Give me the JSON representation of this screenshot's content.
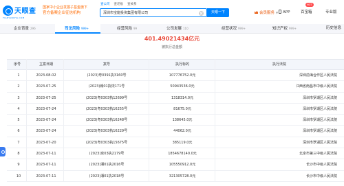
{
  "brand": {
    "name": "天眼查",
    "tagline": "TIANYANCHA.COM",
    "cert_line1": "国家中小企业发展子基金旗下",
    "cert_line2": "官方备案企业征信机构"
  },
  "search": {
    "tabs": [
      "查公司",
      "查老板",
      "查关系"
    ],
    "active_tab": 0,
    "value": "深圳市宝能投资集团有限公司",
    "button_label": "天眼一下"
  },
  "nav": {
    "member_label": "会员服务",
    "app_label": "APP",
    "home_label": "百宝箱",
    "home_badge": "HOT",
    "pro_label": "专业版"
  },
  "tabs": [
    {
      "label": "企业背景",
      "count": "296"
    },
    {
      "label": "司法风险",
      "count": "999+"
    },
    {
      "label": "经营风险",
      "count": "99"
    },
    {
      "label": "公司发展",
      "count": "110"
    },
    {
      "label": "经营状况",
      "count": "999+"
    },
    {
      "label": "知识产权",
      "count": "999+"
    },
    {
      "label": "历史信息",
      "count": ""
    }
  ],
  "active_tab_index": 1,
  "summary": {
    "amount": "401.49021434亿元",
    "label": "被执行总金额"
  },
  "table": {
    "headers": {
      "index": "序号",
      "date": "立案日期",
      "case_no": "案号",
      "amount": "执行标的",
      "court": "执行法院"
    },
    "rows": [
      {
        "index": "1",
        "date": "2023-08-02",
        "case_no": "(2023)粤0391执3160号",
        "amount": "107776752.0元",
        "court": "深圳前海合作区人民法院"
      },
      {
        "index": "2",
        "date": "2023-07-25",
        "case_no": "(2023)赣01执恢171号",
        "amount": "50943536.0元",
        "court": "江西省南昌市中级人民法院"
      },
      {
        "index": "3",
        "date": "2023-07-25",
        "case_no": "(2023)粤0303执12699号",
        "amount": "1318314.0元",
        "court": "深圳市罗湖区人民法院"
      },
      {
        "index": "4",
        "date": "2023-07-24",
        "case_no": "(2023)粤0303执16255号",
        "amount": "81675.0元",
        "court": "深圳市罗湖区人民法院"
      },
      {
        "index": "5",
        "date": "2023-07-24",
        "case_no": "(2023)粤0303执16248号",
        "amount": "138645.0元",
        "court": "深圳市罗湖区人民法院"
      },
      {
        "index": "6",
        "date": "2023-07-24",
        "case_no": "(2023)粤0303执16229号",
        "amount": "44062.0元",
        "court": "深圳市罗湖区人民法院"
      },
      {
        "index": "7",
        "date": "2023-07-20",
        "case_no": "(2023)粤0303执15675号",
        "amount": "385119.0元",
        "court": "深圳市罗湖区人民法院"
      },
      {
        "index": "8",
        "date": "2023-07-11",
        "case_no": "(2023)京03执2179号",
        "amount": "1854678140.0元",
        "court": "北京市第三中级人民法院"
      },
      {
        "index": "9",
        "date": "2023-07-11",
        "case_no": "(2023)湘01执2016号",
        "amount": "105550912.0元",
        "court": "长沙市中级人民法院"
      },
      {
        "index": "10",
        "date": "2023-07-11",
        "case_no": "(2023)湘01执2018号",
        "amount": "321305728.0元",
        "court": "长沙市中级人民法院"
      }
    ]
  },
  "colors": {
    "brand_blue": "#0084ff",
    "accent_red": "#e94b3c",
    "member_orange": "#e8590c"
  }
}
